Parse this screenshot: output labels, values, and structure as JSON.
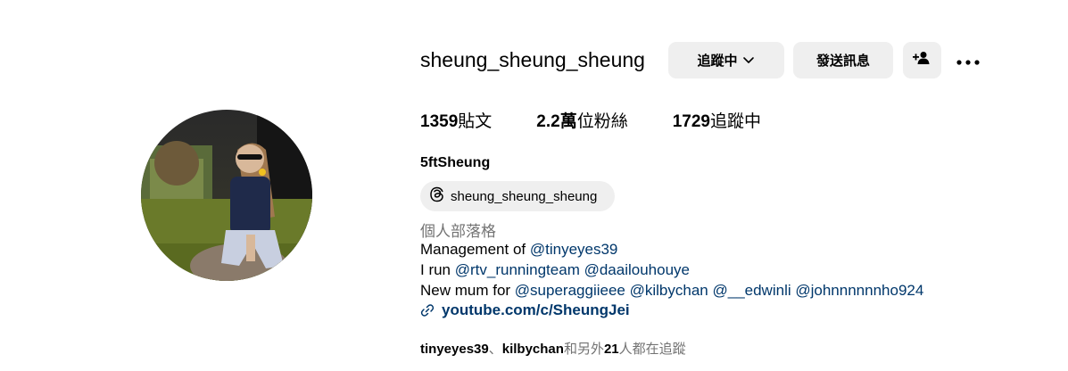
{
  "profile": {
    "username": "sheung_sheung_sheung",
    "full_name": "5ftSheung",
    "avatar_alt": "profile photo"
  },
  "actions": {
    "following_label": "追蹤中",
    "message_label": "發送訊息",
    "add_user_icon": "person-plus-icon",
    "more_icon": "ellipsis-icon"
  },
  "stats": {
    "posts_num": "1359",
    "posts_label": "貼文",
    "followers_num": "2.2萬",
    "followers_label": "位粉絲",
    "following_num": "1729",
    "following_label": "追蹤中"
  },
  "threads": {
    "handle": "sheung_sheung_sheung",
    "icon": "threads-icon"
  },
  "bio": {
    "category": "個人部落格",
    "line1_text": "Management of ",
    "line1_mention": "@tinyeyes39",
    "line2_text": "I run ",
    "line2_mention1": "@rtv_runningteam",
    "line2_mention2": "@daailouhouye",
    "line3_text": "New mum for ",
    "line3_mention1": "@superaggiieee",
    "line3_mention2": "@kilbychan",
    "line3_mention3": "@__edwinli",
    "line3_mention4": "@johnnnnnnho924",
    "link": "youtube.com/c/SheungJei"
  },
  "followed_by": {
    "user1": "tinyeyes39",
    "separator": "、",
    "user2": "kilbychan",
    "text1": "和另外",
    "count": "21",
    "text2": "人都在追蹤"
  },
  "colors": {
    "link": "#00376b",
    "secondary_text": "#737373",
    "button_bg": "#efefef"
  }
}
